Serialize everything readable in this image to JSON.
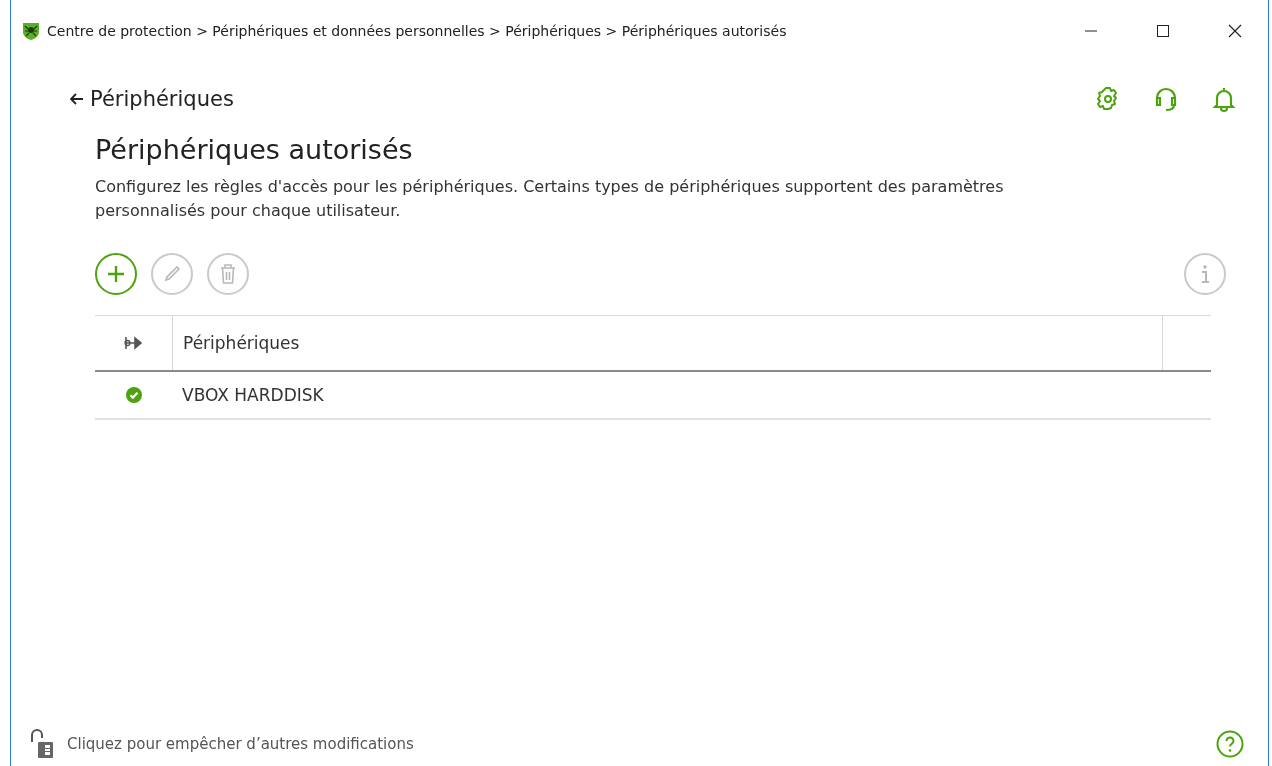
{
  "window": {
    "title": "Centre de protection > Périphériques et données personnelles > Périphériques > Périphériques autorisés"
  },
  "back_link": "Périphériques",
  "heading": "Périphériques autorisés",
  "description": "Configurez les règles d'accès pour les périphériques. Certains types de périphériques supportent des paramètres personnalisés pour chaque utilisateur.",
  "toolbar": [
    {
      "kind": "add",
      "disabled": false
    },
    {
      "kind": "edit",
      "disabled": true
    },
    {
      "kind": "delete",
      "disabled": true
    }
  ],
  "table": {
    "columns": [
      "Périphériques"
    ],
    "rows": [
      {
        "allowed": true,
        "name": "VBOX HARDDISK"
      }
    ]
  },
  "footer": {
    "lock_text": "Cliquez pour empêcher d’autres modifications"
  }
}
